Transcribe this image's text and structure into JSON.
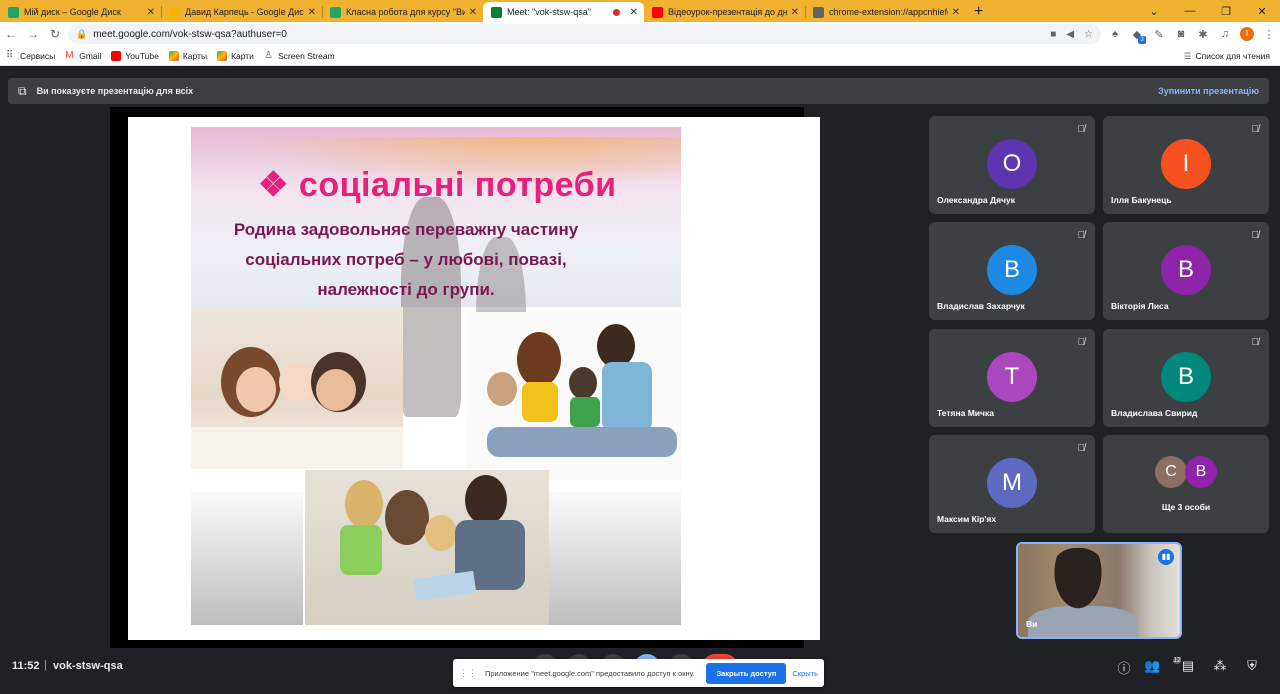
{
  "browser": {
    "tabs": [
      {
        "title": "Мій диск – Google Диск",
        "icon": "google-drive-icon",
        "color": "#1fa463"
      },
      {
        "title": "Давид Карпець - Google Диск. Ч",
        "icon": "google-drive-icon",
        "color": "#f4b400"
      },
      {
        "title": "Класна робота для курсу \"Вихо",
        "icon": "google-classroom-icon",
        "color": "#25a667"
      },
      {
        "title": "Meet: \"vok-stsw-qsa\"",
        "icon": "google-meet-icon",
        "color": "#00832d",
        "active": true
      },
      {
        "title": "Відеоурок-презентація до дня у",
        "icon": "youtube-icon",
        "color": "#ff0000"
      },
      {
        "title": "chrome-extension://appcnhiefcio",
        "icon": "extension-icon",
        "color": "#5f6368"
      }
    ],
    "url": "meet.google.com/vok-stsw-qsa?authuser=0",
    "profile_initial": "I",
    "extension_badge": "3",
    "bookmarks": [
      {
        "label": "Сервисы",
        "icon": "apps-grid-icon",
        "color": "#5f6368"
      },
      {
        "label": "Gmail",
        "icon": "gmail-icon",
        "color": "#ea4335"
      },
      {
        "label": "YouTube",
        "icon": "youtube-icon",
        "color": "#ff0000"
      },
      {
        "label": "Карты",
        "icon": "maps-icon",
        "color": "#34a853"
      },
      {
        "label": "Карти",
        "icon": "maps-icon",
        "color": "#34a853"
      },
      {
        "label": "Screen Stream",
        "icon": "screen-stream-icon",
        "color": "#5f6368"
      }
    ],
    "reading_list": "Список для чтения"
  },
  "meet": {
    "presenting_text": "Ви показуєте презентацію для всіх",
    "stop_presenting": "Зупинити презентацію",
    "slide": {
      "title": "❖ соціальні потреби",
      "text": "Родина задовольняє переважну частину соціальних потреб – у любові, повазі, належності до групи."
    },
    "participants": [
      {
        "initial": "О",
        "name": "Олександра Дячук",
        "color": "#5e35b1"
      },
      {
        "initial": "І",
        "name": "Ілля Бакунець",
        "color": "#f4511e"
      },
      {
        "initial": "В",
        "name": "Владислав Захарчук",
        "color": "#1e88e5"
      },
      {
        "initial": "В",
        "name": "Вікторія Лиса",
        "color": "#8e24aa"
      },
      {
        "initial": "Т",
        "name": "Тетяна Мичка",
        "color": "#ab47bc"
      },
      {
        "initial": "В",
        "name": "Владислава Свирид",
        "color": "#00897b"
      },
      {
        "initial": "М",
        "name": "Максим Кір'ях",
        "color": "#5c6bc0"
      }
    ],
    "more_tile": {
      "initials": [
        "С",
        "В"
      ],
      "colors": [
        "#8d6e63",
        "#8e24aa"
      ],
      "label": "Ще 3 особи"
    },
    "self_name": "Ви",
    "time": "11:52",
    "meeting_code": "vok-stsw-qsa",
    "people_count": "12",
    "notification": {
      "text": "Приложение \"meet.google.com\" предоставило доступ к окну.",
      "close_access": "Закрыть доступ",
      "hide": "Скрыть"
    }
  }
}
